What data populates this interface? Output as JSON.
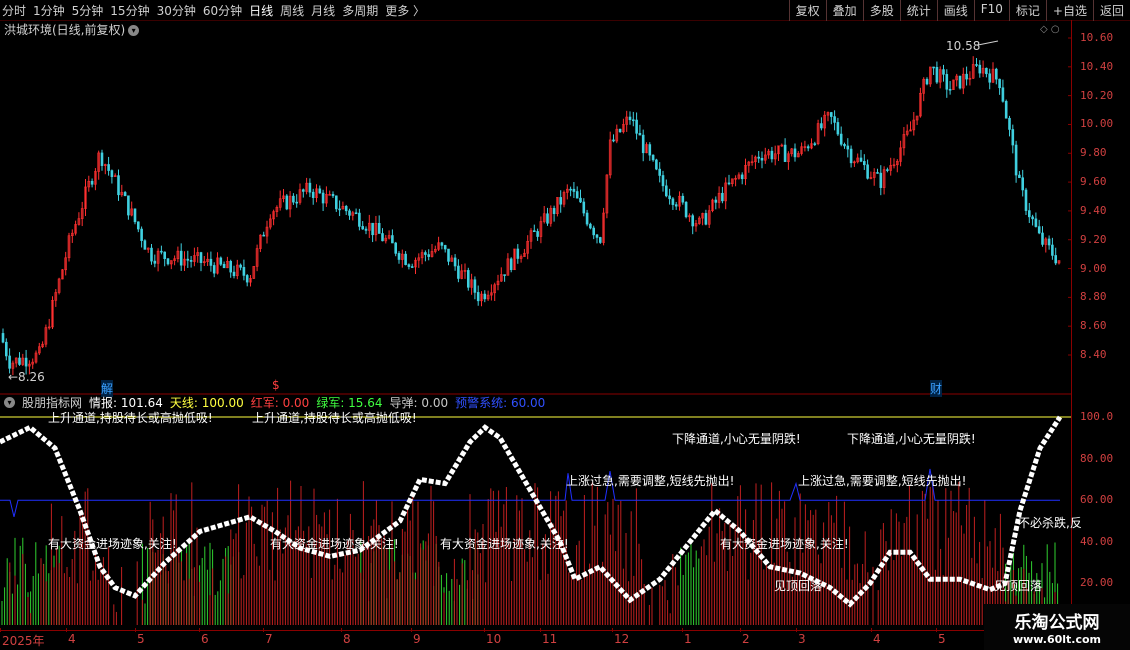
{
  "toolbar": {
    "periods": [
      "分时",
      "1分钟",
      "5分钟",
      "15分钟",
      "30分钟",
      "60分钟",
      "日线",
      "周线",
      "月线",
      "多周期",
      "更多 〉"
    ],
    "active_period": "日线",
    "right_buttons": [
      "复权",
      "叠加",
      "多股",
      "统计",
      "画线",
      "F10",
      "标记",
      "+自选",
      "返回"
    ]
  },
  "main_panel": {
    "title": "洪城环境(日线,前复权)",
    "high_label": "10.58",
    "low_label": "8.26",
    "y_axis": [
      "10.60",
      "10.40",
      "10.20",
      "10.00",
      "9.80",
      "9.60",
      "9.40",
      "9.20",
      "9.00",
      "8.80",
      "8.60",
      "8.40"
    ],
    "markers": [
      {
        "text": "解",
        "color": "#3aa0ff"
      },
      {
        "text": "$",
        "color": "#ff4040"
      },
      {
        "text": "财",
        "color": "#3aa0ff"
      }
    ]
  },
  "indicator_panel": {
    "name": "股朋指标网",
    "fields": [
      {
        "label": "情报: 101.64",
        "color": "#ffffff"
      },
      {
        "label": "天线: 100.00",
        "color": "#ffff40"
      },
      {
        "label": "红军: 0.00",
        "color": "#ff4040"
      },
      {
        "label": "绿军: 15.64",
        "color": "#40ff40"
      },
      {
        "label": "导弹: 0.00",
        "color": "#c8c8c8"
      },
      {
        "label": "预警系统: 60.00",
        "color": "#3050ff"
      }
    ],
    "y_axis": [
      "100.0",
      "80.00",
      "60.00",
      "40.00",
      "20.00"
    ],
    "annotations": [
      "上升通道,持股待长或高抛低吸!",
      "上升通道,持股待长或高抛低吸!",
      "下降通道,小心无量阴跌!",
      "下降通道,小心无量阴跌!",
      "上涨过急,需要调整,短线先抛出!",
      "上涨过急,需要调整,短线先抛出!",
      "有大资金进场迹象,关注!",
      "有大资金进场迹象,关注!",
      "有大资金进场迹象,关注!",
      "有大资金进场迹象,关注!",
      "见顶回落",
      "见顶回落",
      "不必杀跌,反"
    ]
  },
  "date_axis": [
    "2025年",
    "4",
    "5",
    "6",
    "7",
    "8",
    "9",
    "10",
    "11",
    "12",
    "1",
    "2",
    "3",
    "4",
    "5"
  ],
  "watermark": {
    "title": "乐淘公式网",
    "url": "www.60lt.com"
  },
  "colors": {
    "up": "#ff3030",
    "down": "#40d0e0",
    "grid": "#8a0000",
    "curve": "#ffffff",
    "warning_line": "#2030ff",
    "sky_line": "#ffff40"
  }
}
